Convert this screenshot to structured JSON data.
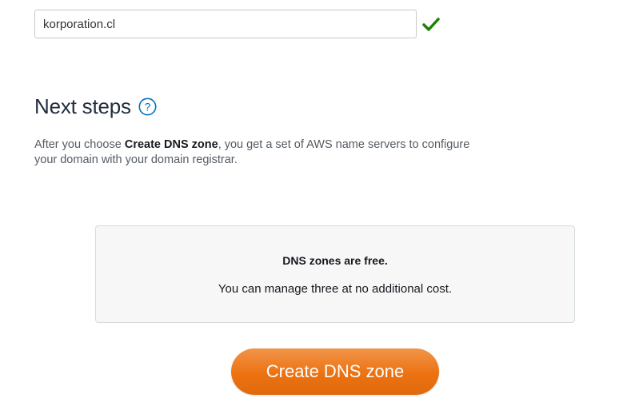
{
  "domain": {
    "value": "korporation.cl",
    "valid_icon": "checkmark-icon",
    "valid_color": "#1d8102"
  },
  "next_steps": {
    "title": "Next steps",
    "help_icon": "question-circle-icon",
    "help_color": "#0073bb",
    "description_before": "After you choose ",
    "description_bold": "Create DNS zone",
    "description_after": ", you get a set of AWS name servers to configure your domain with your domain registrar."
  },
  "info_box": {
    "title": "DNS zones are free.",
    "text": "You can manage three at no additional cost."
  },
  "actions": {
    "create_label": "Create DNS zone",
    "accent_color": "#ec7211"
  }
}
